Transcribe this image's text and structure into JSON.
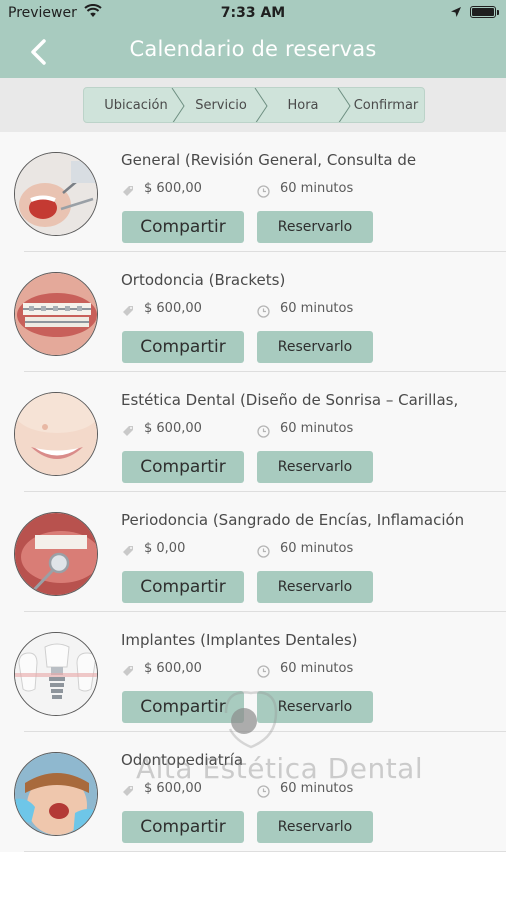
{
  "status_bar": {
    "carrier": "Previewer",
    "time": "7:33 AM"
  },
  "header": {
    "title": "Calendario de reservas",
    "back_icon": "chevron-left-icon",
    "background_color": "#a8cbbf"
  },
  "steps": [
    {
      "label": "Ubicación"
    },
    {
      "label": "Servicio"
    },
    {
      "label": "Hora"
    },
    {
      "label": "Confirmar"
    }
  ],
  "services": [
    {
      "name": "General (Revisión General, Consulta de",
      "price": "$ 600,00",
      "duration": "60 minutos",
      "share_label": "Compartir",
      "book_label": "Reservarlo",
      "image": "dental-checkup-photo"
    },
    {
      "name": "Ortodoncia (Brackets)",
      "price": "$ 600,00",
      "duration": "60 minutos",
      "share_label": "Compartir",
      "book_label": "Reservarlo",
      "image": "braces-photo"
    },
    {
      "name": "Estética Dental (Diseño de Sonrisa – Carillas,",
      "price": "$ 600,00",
      "duration": "60 minutos",
      "share_label": "Compartir",
      "book_label": "Reservarlo",
      "image": "smile-photo"
    },
    {
      "name": "Periodoncia (Sangrado de Encías, Inflamación",
      "price": "$ 0,00",
      "duration": "60 minutos",
      "share_label": "Compartir",
      "book_label": "Reservarlo",
      "image": "gum-exam-photo"
    },
    {
      "name": "Implantes (Implantes Dentales)",
      "price": "$ 600,00",
      "duration": "60 minutos",
      "share_label": "Compartir",
      "book_label": "Reservarlo",
      "image": "implant-illustration"
    },
    {
      "name": "Odontopediatría",
      "price": "$ 600,00",
      "duration": "60 minutos",
      "share_label": "Compartir",
      "book_label": "Reservarlo",
      "image": "child-dentist-photo"
    }
  ],
  "watermark": {
    "text": "Alta Estética Dental"
  },
  "colors": {
    "accent": "#a8cbbf",
    "steps_bg": "#cfe3da",
    "list_bg": "#f8f8f8"
  }
}
